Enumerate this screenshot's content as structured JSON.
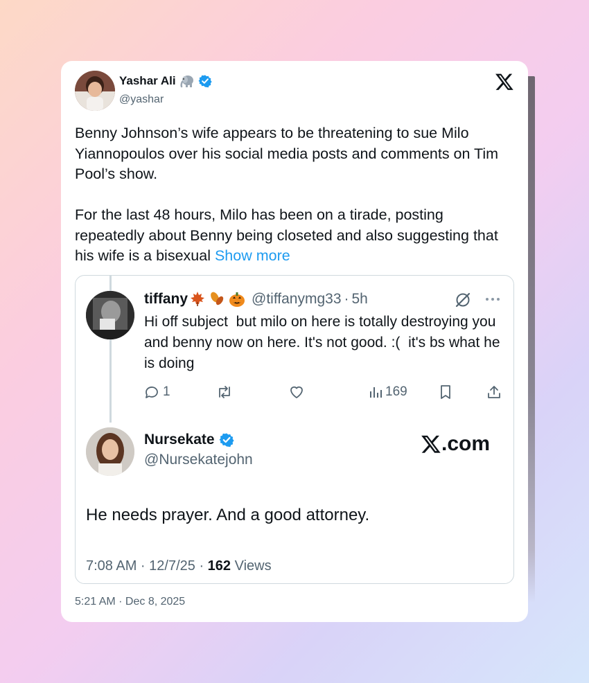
{
  "colors": {
    "accent": "#1d9bf0",
    "text": "#0f1419",
    "secondary": "#536471",
    "border": "#cfd9de"
  },
  "post": {
    "author_name": "Yashar Ali",
    "author_emoji": "elephant-icon",
    "handle": "@yashar",
    "text": "Benny Johnson’s wife appears to be threatening to sue Milo Yiannopoulos over his social media posts and comments on Tim Pool’s show.\n\nFor the last 48 hours, Milo has been on a tirade, posting repeatedly about Benny being closeted and also suggesting that his wife is a bisexual ",
    "show_more": "Show more",
    "timestamp": "5:21 AM · Dec 8, 2025"
  },
  "quoted": {
    "parent": {
      "name": "tiffany",
      "emojis": [
        "maple-leaf-icon",
        "fallen-leaves-icon",
        "jack-o-lantern-icon"
      ],
      "handle": "@tiffanymg33",
      "dot": "·",
      "time": "5h",
      "text": "Hi off subject  but milo on here is totally destroying you and benny now on here. It's not good. :(  it's bs what he is doing",
      "replies": "1",
      "views": "169"
    },
    "reply": {
      "name": "Nursekate",
      "handle": "@Nursekatejohn",
      "watermark": ".com",
      "text": "He needs prayer. And a good attorney.",
      "meta_prefix": "7:08 AM · 12/7/25 · ",
      "views_count": "162",
      "views_label": " Views"
    }
  }
}
